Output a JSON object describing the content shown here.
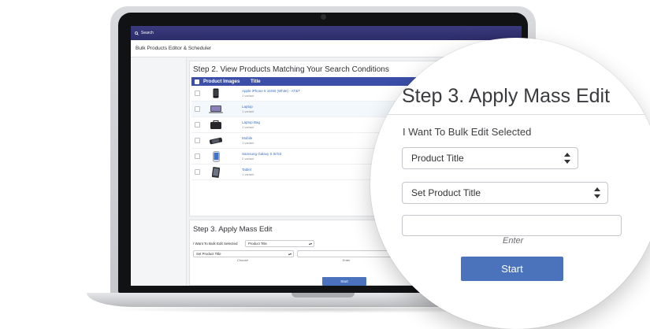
{
  "app": {
    "search_label": "Search",
    "header_title": "Bulk Products Editor & Scheduler"
  },
  "step2": {
    "title": "Step 2. View Products Matching Your Search Conditions",
    "columns": [
      "Product Images",
      "Title"
    ],
    "products": [
      {
        "title": "Apple iPhone 5 16GB (White) - AT&T",
        "variants": "1 variant",
        "image": "phone-icon"
      },
      {
        "title": "Laptop",
        "variants": "1 variant",
        "image": "laptop-icon"
      },
      {
        "title": "Laptop Bag",
        "variants": "1 variant",
        "image": "bag-icon"
      },
      {
        "title": "Mobile",
        "variants": "1 variant",
        "image": "mobile-icon"
      },
      {
        "title": "Samsung Galaxy S III/S3",
        "variants": "2 variant",
        "image": "phone-icon"
      },
      {
        "title": "Tablet",
        "variants": "1 variant",
        "image": "tablet-icon"
      }
    ]
  },
  "step3": {
    "title": "Step 3. Apply Mass Edit",
    "bulk_label": "I Want To Bulk Edit Selected",
    "field_select": "Product Title",
    "action_select": "Set Product Title",
    "choose_caption": "Choose",
    "enter_caption": "Enter",
    "start_label": "Start",
    "value_input": ""
  },
  "colors": {
    "topbar": "#2c2d6a",
    "table_header": "#3b4fa8",
    "primary_button": "#4b73bc",
    "link": "#3b6fc2"
  }
}
